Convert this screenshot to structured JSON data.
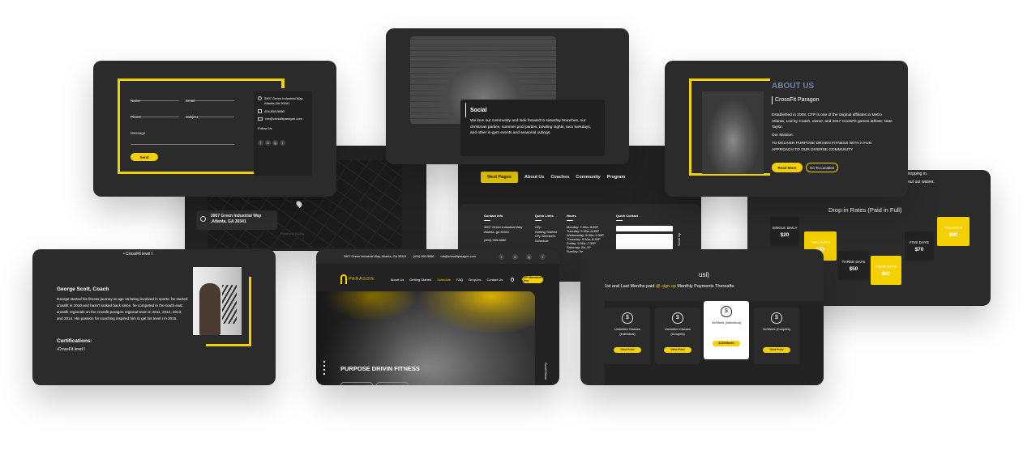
{
  "contact_card": {
    "fields": {
      "name": "Name",
      "email": "Email",
      "phone": "Phone",
      "subject": "Subject",
      "message": "Message"
    },
    "send_label": "Send",
    "address": "3907 Green Industrial Way Atlanta,GA 30341",
    "phone": "404-555-5880",
    "email": "rob@crossfitparagon.com",
    "follow": "Follow Us",
    "social": [
      "f",
      "in",
      "ig",
      "t"
    ]
  },
  "map_card": {
    "address": "3907 Green Industrial Way ,Atlanta, GA 30341",
    "map_caption": "Roselane Kuling"
  },
  "social_card": {
    "title": "Social",
    "text": "We love our community and look forward to saturday brunches, our christmas parties, summer pool parties, bowling nights, taco tuesdays, and other in-gym events and seasonal outings."
  },
  "about_card": {
    "heading": "ABOUT US",
    "subheading": "CrossFit Paragon",
    "text": "Established in 2008, CFP is one of the original affiliates in Metro Atlanta, Led by Coach, owner, and 2017 CrossFit games athlete; Nate Taylor.",
    "mission_label": "Our Mission:",
    "mission": "TO DELIVER PURPOSE DRIVEN FITNESS WITH A FUN APPROACH TO OUR DIVERSE COMMUNITY",
    "read_more": "Read More",
    "go_location": "Go To Location"
  },
  "footer_card": {
    "nav": [
      "Next Pages",
      "About Us",
      "Coaches",
      "Community",
      "Program"
    ],
    "cols": {
      "contact": {
        "title": "Contact Info",
        "address": "3907 Green Industrial Way Atlanta, ga 30341",
        "phone": "(404) 955-5880"
      },
      "links": {
        "title": "Quick Links",
        "items": [
          "CFp",
          "Getting Started",
          "CFp Members",
          "Schedule"
        ]
      },
      "hours": {
        "title": "Hours",
        "items": [
          "Monday: 7:00a–8:30P",
          "Tuesday: 5:30a–8:30P",
          "Wednesday: 5:30a–9:30P",
          "Thursday: 5:30a–8:30P",
          "Friday: 5:30a–7:30P",
          "Saturday: 8a–1P",
          "Sunday: 9a–1P, 5P–8P"
        ]
      },
      "quick": {
        "title": "Quick Contact",
        "send": "Send"
      }
    },
    "scroll_up": "Scroll Up"
  },
  "droprates_card": {
    "top_text_1": "dropping in.",
    "top_text_2": "fill out our waiver.",
    "title": "Drop-in Rates (Paid in Full)",
    "rates": [
      {
        "label": "SINGLE DAILY",
        "price": "$20",
        "highlight": false
      },
      {
        "label": "TWO DAYS",
        "price": "$35",
        "highlight": true
      },
      {
        "label": "THREE DAYS",
        "price": "$50",
        "highlight": false
      },
      {
        "label": "FOUR DAYS",
        "price": "$60",
        "highlight": true
      },
      {
        "label": "FIVE DAYS",
        "price": "$70",
        "highlight": false
      },
      {
        "label": "TEN DAYS",
        "price": "$90",
        "highlight": true
      }
    ]
  },
  "coach_card": {
    "top": "• CrossFit level I",
    "name": "George Scott, Coach",
    "bio": "George started his fitness journey at age 16 being involved in sports. he started crossfit in 2010 and hasn't looked back since. he competed in the south east crossfit regionals on the crossfit paragon regional team in 2011, 2012, 2013, and 2014. His passion for coaching inspired him to get his level I in 2015.",
    "cert_title": "Certifications:",
    "cert": "•CrossFit level I"
  },
  "hero_card": {
    "topbar": {
      "address": "3907 Green Industrial Way, Atlanta, GA 30341",
      "phone": "(404) 555-5880",
      "email": "rob@crossfitparagon.com"
    },
    "logo": "PARAGON",
    "nav": [
      "About Us",
      "Getting Started",
      "Schedule",
      "FAQ",
      "Drop-ins",
      "Contact Us"
    ],
    "cta": "CFP Members Only",
    "hero_text": "PURPOSE DRIVIN FITNESS",
    "scroll": "Scroll Down"
  },
  "pricing_card": {
    "heading": "usi)",
    "subtext_a": "1st and Last Months paid ",
    "subtext_link": "@ sign up",
    "subtext_b": " Monthly Payments Thereafte",
    "plans": [
      {
        "name": "Unlimited Classes (individual)",
        "button": "View Price",
        "active": false
      },
      {
        "name": "Unlimited Classes (Couples)",
        "button": "View Price",
        "active": false
      },
      {
        "name": "3x/Week (individual)",
        "button": "$130/Month",
        "active": true
      },
      {
        "name": "3x/Week (Couples)",
        "button": "View Price",
        "active": false
      }
    ]
  },
  "colors": {
    "accent": "#f5d000",
    "card": "#2b2b2b",
    "bg": "#ffffff"
  }
}
